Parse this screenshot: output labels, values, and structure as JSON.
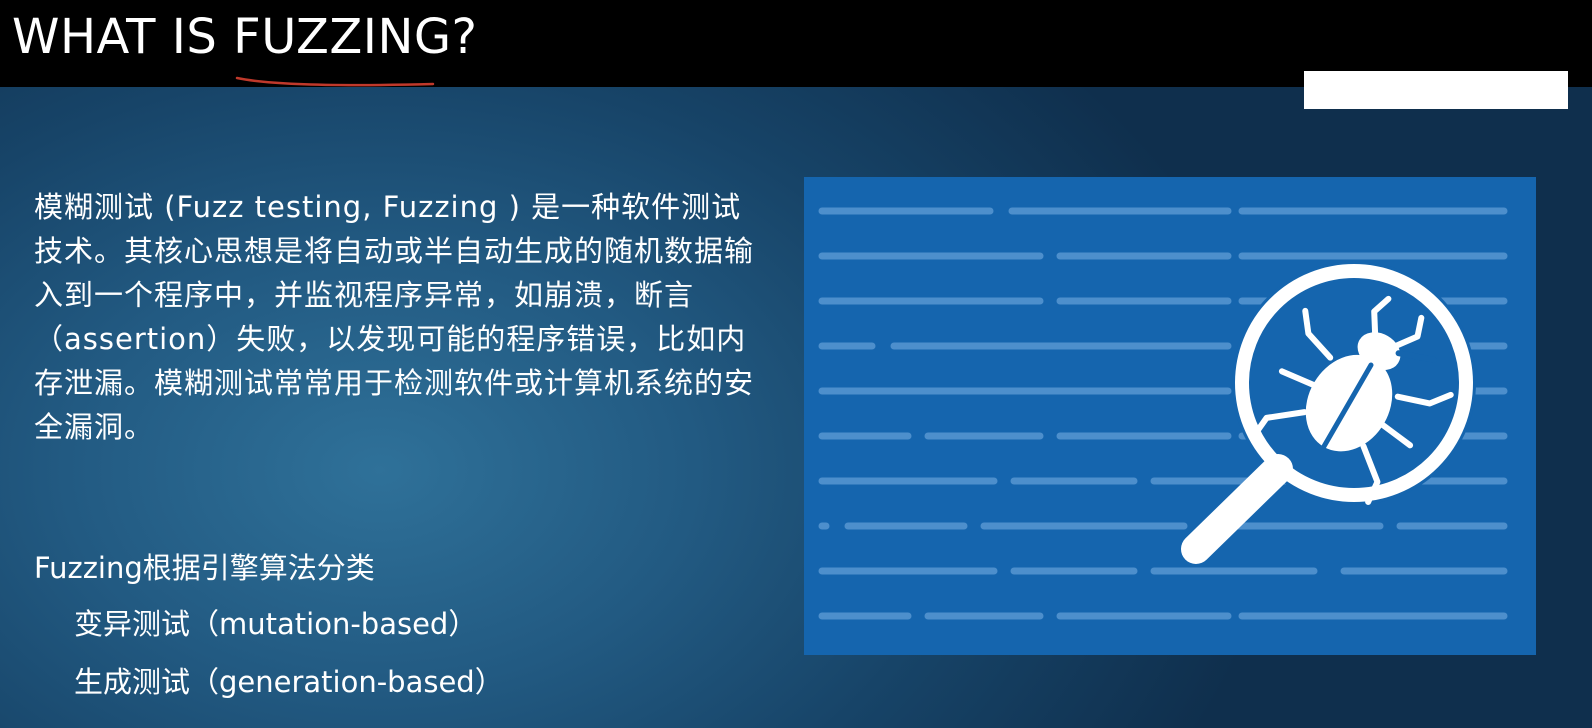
{
  "slide": {
    "title": "WHAT IS FUZZING?",
    "intro_text": "模糊测试 (Fuzz testing, Fuzzing ) 是一种软件测试技术。其核心思想是将自动或半自动生成的随机数据输入到一个程序中，并监视程序异常，如崩溃，断言（assertion）失败，以发现可能的程序错误，比如内存泄漏。模糊测试常常用于检测软件或计算机系统的安全漏洞。",
    "classification_heading": "Fuzzing根据引擎算法分类",
    "classifications": [
      "变异测试（mutation-based）",
      "生成测试（generation-based）"
    ]
  },
  "colors": {
    "title_bar": "#000000",
    "underline_annotation": "#c0392b",
    "illustration_panel": "#1565ae",
    "code_lines": "#4d8fcc",
    "magnifier": "#ffffff"
  },
  "icons": {
    "illustration": "magnifying-glass-over-code-with-bug-icon"
  }
}
